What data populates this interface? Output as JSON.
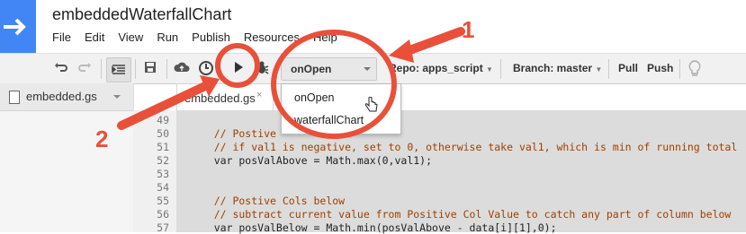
{
  "app": {
    "title": "embeddedWaterfallChart",
    "menu": [
      "File",
      "Edit",
      "View",
      "Run",
      "Publish",
      "Resources",
      "Help"
    ]
  },
  "toolbar": {
    "icons": [
      "undo-icon",
      "redo-icon",
      "indent-icon",
      "save-icon",
      "cloud-icon",
      "clock-icon",
      "run-icon",
      "debug-icon",
      "lightbulb-icon"
    ],
    "selected_function": "onOpen",
    "repo": "Repo: apps_script",
    "branch": "Branch: master",
    "pull": "Pull",
    "push": "Push"
  },
  "files": {
    "current": "embedded.gs"
  },
  "editor": {
    "tab": "embedded.gs",
    "close": "×",
    "lines": [
      {
        "n": "49",
        "text": ""
      },
      {
        "n": "50",
        "text": "    // Postive"
      },
      {
        "n": "51",
        "text": "    // if val1 is negative, set to 0, otherwise take val1, which is min of running total"
      },
      {
        "n": "52",
        "text": "    var posValAbove = Math.max(0,val1);"
      },
      {
        "n": "53",
        "text": ""
      },
      {
        "n": "54",
        "text": ""
      },
      {
        "n": "55",
        "text": "    // Postive Cols below"
      },
      {
        "n": "56",
        "text": "    // subtract current value from Positive Col Value to catch any part of column below"
      },
      {
        "n": "57",
        "text": "    var posValBelow = Math.min(posValAbove - data[i][1],0);"
      }
    ]
  },
  "dropdown": {
    "options": [
      "onOpen",
      "waterfallChart"
    ]
  },
  "annotations": {
    "label1": "1",
    "label2": "2",
    "accent": "#e8503a"
  }
}
